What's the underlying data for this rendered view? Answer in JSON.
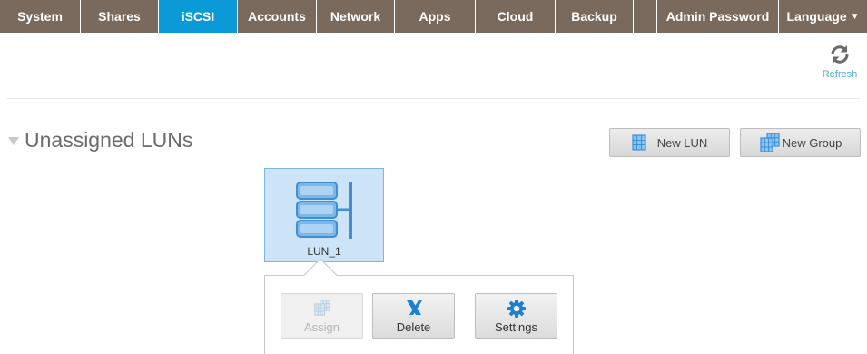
{
  "nav": {
    "items": [
      {
        "label": "System",
        "active": false
      },
      {
        "label": "Shares",
        "active": false
      },
      {
        "label": "iSCSI",
        "active": true
      },
      {
        "label": "Accounts",
        "active": false
      },
      {
        "label": "Network",
        "active": false
      },
      {
        "label": "Apps",
        "active": false
      },
      {
        "label": "Cloud",
        "active": false
      },
      {
        "label": "Backup",
        "active": false
      },
      {
        "label": "",
        "active": false
      },
      {
        "label": "Admin Password",
        "active": false
      },
      {
        "label": "Language",
        "active": false
      }
    ],
    "caret_icon": "triangle-down-icon",
    "colors": {
      "bar": "#7a6a5e",
      "active": "#0a9ad8",
      "text": "#ffffff"
    }
  },
  "refresh": {
    "label": "Refresh",
    "icon": "refresh-icon"
  },
  "section": {
    "title": "Unassigned LUNs",
    "collapse_icon": "triangle-down-icon"
  },
  "toolbar": {
    "new_lun_label": "New LUN",
    "new_group_label": "New Group",
    "new_lun_icon": "lun-icon",
    "new_group_icon": "group-icon"
  },
  "lun": {
    "name": "LUN_1",
    "icon": "lun-storage-icon",
    "selected": true
  },
  "popup": {
    "assign_label": "Assign",
    "delete_label": "Delete",
    "settings_label": "Settings",
    "assign_enabled": false
  }
}
